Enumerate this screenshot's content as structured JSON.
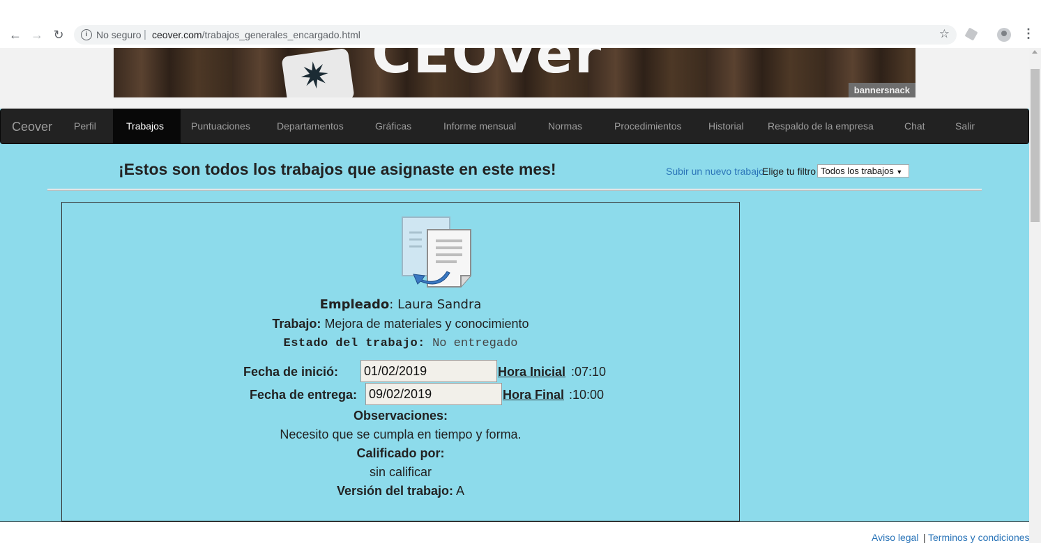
{
  "browser": {
    "security_label": "No seguro",
    "url_host": "ceover.com",
    "url_path": "/trabajos_generales_encargado.html"
  },
  "banner": {
    "logo_text": "CEOver",
    "badge": "bannersnack"
  },
  "navbar": {
    "brand": "Ceover",
    "items": [
      {
        "label": "Perfil"
      },
      {
        "label": "Trabajos"
      },
      {
        "label": "Puntuaciones"
      },
      {
        "label": "Departamentos"
      },
      {
        "label": "Gráficas"
      },
      {
        "label": "Informe mensual"
      },
      {
        "label": "Normas"
      },
      {
        "label": "Procedimientos"
      },
      {
        "label": "Historial"
      },
      {
        "label": "Respaldo de la empresa"
      },
      {
        "label": "Chat"
      },
      {
        "label": "Salir"
      }
    ],
    "active": "Trabajos"
  },
  "header": {
    "title": "¡Estos son todos los trabajos que asignaste en este mes!",
    "upload_link": "Subir un nuevo trabajo",
    "filter_label": "Elige tu filtro",
    "filter_value": "Todos los trabajos"
  },
  "job": {
    "empleado_label": "Empleado",
    "empleado_value": "Laura Sandra",
    "trabajo_label": "Trabajo:",
    "trabajo_value": "Mejora de materiales y conocimiento",
    "estado_label": "Estado del trabajo:",
    "estado_value": "No entregado",
    "fecha_inicio_label": "Fecha de inició:",
    "fecha_inicio_value": "01/02/2019",
    "hora_inicial_label": "Hora Inicial",
    "hora_inicial_value": ":07:10",
    "fecha_entrega_label": "Fecha de entrega:",
    "fecha_entrega_value": "09/02/2019",
    "hora_final_label": "Hora Final",
    "hora_final_value": ":10:00",
    "observaciones_label": "Observaciones:",
    "observaciones_value": "Necesito que se cumpla en tiempo y forma.",
    "calificado_label": "Calificado por:",
    "calificado_value": "sin calificar",
    "version_label": "Versión del trabajo:",
    "version_value": "A"
  },
  "footer": {
    "aviso": "Aviso legal",
    "separator": "|",
    "terminos": "Terminos y condiciones"
  },
  "colors": {
    "page_bg": "#8ddbeb",
    "navbar_bg": "#222222",
    "link": "#2a74b8"
  }
}
